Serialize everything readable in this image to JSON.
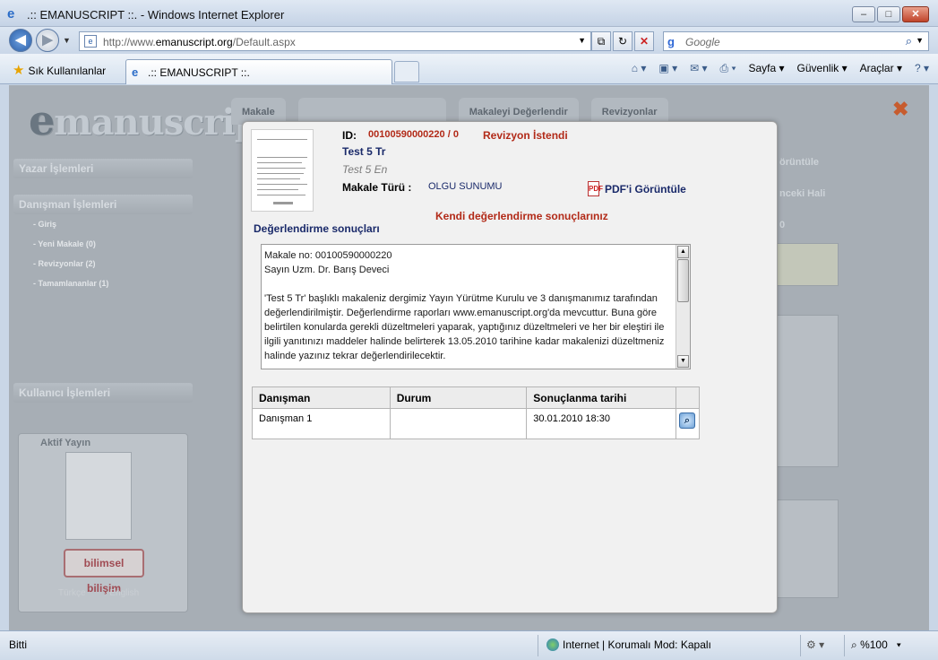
{
  "window": {
    "title": ".:: EMANUSCRIPT ::. - Windows Internet Explorer",
    "min": "–",
    "max": "□",
    "close": "✕"
  },
  "nav": {
    "url_prefix": "http://www.",
    "url_domain": "emanuscript.org",
    "url_path": "/Default.aspx",
    "search_placeholder": "Google"
  },
  "cmdbar": {
    "favorites": "Sık Kullanılanlar",
    "tab_title": ".:: EMANUSCRIPT ::.",
    "tools": [
      "Sayfa",
      "Güvenlik",
      "Araçlar"
    ]
  },
  "site": {
    "logo": "manuscript",
    "logo_e": "e",
    "sections": {
      "yazar": "Yazar İşlemleri",
      "danisman": "Danışman İşlemleri",
      "kullanici": "Kullanıcı İşlemleri"
    },
    "danisman_items": [
      "- Giriş",
      "- Yeni Makale (0)",
      "- Revizyonlar (2)",
      "- Tamamlananlar (1)"
    ],
    "aktif_yayin": "Aktif Yayın",
    "bilimsel": "bilimsel bilişim",
    "lang_tr": "Türkçe",
    "lang_en": "English",
    "tabs": [
      "Makale",
      "Makaleyi Değerlendir",
      "Revizyonlar"
    ],
    "bg_right": [
      "örüntüle",
      "nceki Hali",
      "0"
    ]
  },
  "modal": {
    "id_label": "ID:",
    "id_value": "00100590000220 / 0",
    "status": "Revizyon İstendi",
    "title_tr": "Test 5 Tr",
    "title_en": "Test 5 En",
    "type_label": "Makale Türü :",
    "type_value": "OLGU SUNUMU",
    "pdf_link": "PDF'i Görüntüle",
    "own_results": "Kendi değerlendirme sonuçlarınız",
    "results_heading": "Değerlendirme sonuçları",
    "results_text": "Makale no: 00100590000220\nSayın Uzm. Dr. Barış Deveci\n\n'Test 5 Tr' başlıklı makaleniz dergimiz Yayın Yürütme Kurulu ve 3 danışmanımız tarafından değerlendirilmiştir. Değerlendirme raporları www.emanuscript.org'da mevcuttur. Buna göre belirtilen konularda gerekli düzeltmeleri yaparak, yaptığınız düzeltmeleri ve her bir eleştiri ile ilgili yanıtınızı maddeler halinde belirterek 13.05.2010 tarihine kadar makalenizi düzeltmeniz halinde yazınız tekrar değerlendirilecektir.",
    "table": {
      "headers": [
        "Danışman",
        "Durum",
        "Sonuçlanma tarihi",
        ""
      ],
      "rows": [
        {
          "danisman": "Danışman 1",
          "durum": "",
          "tarih": "30.01.2010 18:30"
        }
      ]
    }
  },
  "statusbar": {
    "done": "Bitti",
    "zone": "Internet | Korumalı Mod: Kapalı",
    "zoom": "%100"
  }
}
